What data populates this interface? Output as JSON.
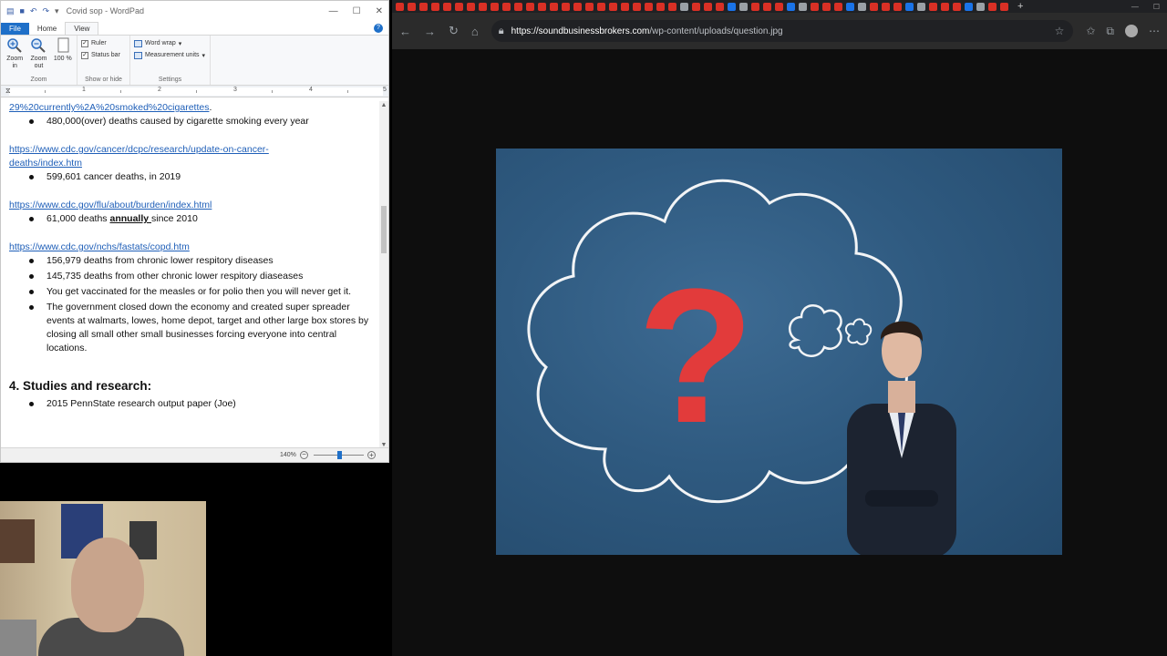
{
  "wordpad": {
    "title": "Covid sop - WordPad",
    "tabs": {
      "file": "File",
      "home": "Home",
      "view": "View"
    },
    "ribbon": {
      "zoom_in": "Zoom in",
      "zoom_out": "Zoom out",
      "zoom_100": "100 %",
      "group_zoom": "Zoom",
      "ruler": "Ruler",
      "status_bar": "Status bar",
      "group_show_hide": "Show or hide",
      "word_wrap": "Word wrap",
      "measurement_units": "Measurement units",
      "group_settings": "Settings"
    },
    "ruler_marks": [
      "1",
      "2",
      "3",
      "4",
      "5"
    ],
    "doc": {
      "link1": "29%20currently%2A%20smoked%20cigarettes",
      "link1_suffix": ".",
      "bullet1": "480,000(over) deaths caused by cigarette smoking every year",
      "link2_line1": "https://www.cdc.gov/cancer/dcpc/research/update-on-cancer-",
      "link2_line2": "deaths/index.htm",
      "bullet2": "599,601 cancer deaths, in 2019",
      "link3": "https://www.cdc.gov/flu/about/burden/index.html",
      "bullet3_pre": "61,000 deaths ",
      "bullet3_bold": "annually ",
      "bullet3_post": "since 2010",
      "link4": "https://www.cdc.gov/nchs/fastats/copd.htm",
      "bullet4": "156,979 deaths from chronic lower respitory diseases",
      "bullet5": "145,735 deaths from other chronic lower respitory diaseases",
      "bullet6": "You get vaccinated for the measles or for polio then you will never get it.",
      "bullet7": "The government closed down the economy and created super spreader events at walmarts, lowes, home depot, target and other large box stores by closing all small other small businesses forcing everyone into central locations.",
      "heading": "4. Studies and research:",
      "bullet8": "2015 PennState research output paper (Joe)"
    },
    "status": {
      "zoom_level": "140%",
      "zoom_fraction": 0.5
    }
  },
  "browser": {
    "url_host": "https://soundbusinessbrokers.com",
    "url_path": "/wp-content/uploads/question.jpg",
    "tab_color": "#d93025"
  },
  "image": {
    "question_mark": "?",
    "question_color": "#e23b3b",
    "chalk_color": "#f2f4f6"
  }
}
